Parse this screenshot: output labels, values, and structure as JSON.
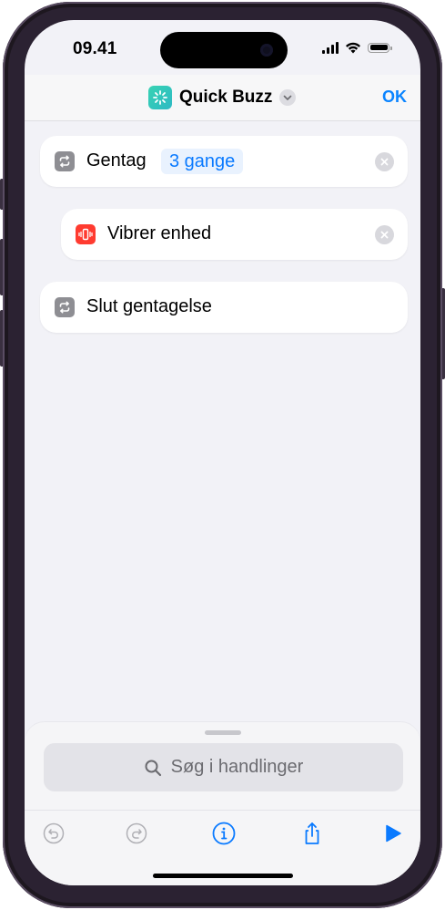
{
  "status_bar": {
    "time": "09.41"
  },
  "nav": {
    "title": "Quick Buzz",
    "done_label": "OK",
    "icon": "sparkle-wand-icon",
    "accent_color": "#0a84ff",
    "app_icon_color": "#35c9bb"
  },
  "actions": [
    {
      "label": "Gentag",
      "param": "3 gange",
      "icon": "repeat-icon",
      "icon_color": "#8e8e93",
      "removable": true
    },
    {
      "label": "Vibrer enhed",
      "icon": "vibrate-device-icon",
      "icon_color": "#ff3b30",
      "removable": true,
      "indented": true
    },
    {
      "label": "Slut gentagelse",
      "icon": "repeat-icon",
      "icon_color": "#8e8e93",
      "removable": false
    }
  ],
  "search": {
    "placeholder": "Søg i handlinger"
  },
  "toolbar": {
    "buttons": [
      "undo-icon",
      "redo-icon",
      "info-icon",
      "share-icon",
      "play-icon"
    ]
  }
}
